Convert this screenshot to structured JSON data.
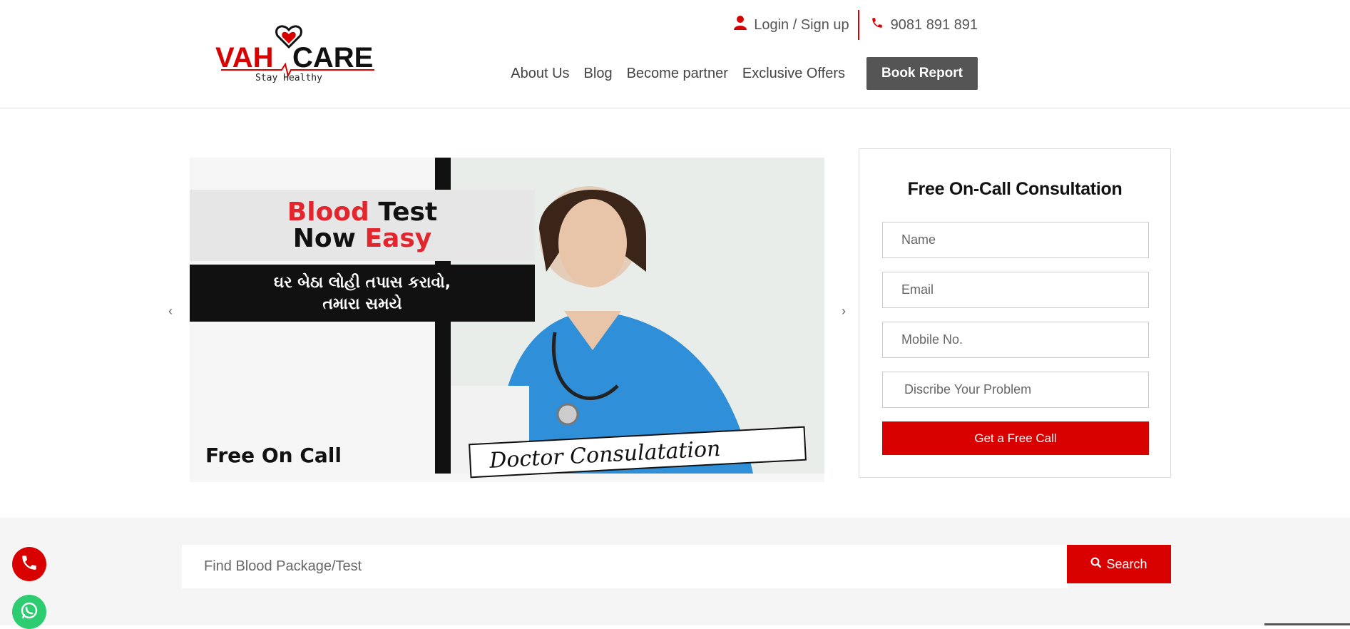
{
  "brand": {
    "name_left": "VAH",
    "name_right": "CARE",
    "tagline": "Stay Healthy"
  },
  "topbar": {
    "login_label": "Login / Sign up",
    "phone": "9081 891 891"
  },
  "nav": {
    "items": [
      "About Us",
      "Blog",
      "Become partner",
      "Exclusive Offers"
    ],
    "book_label": "Book Report"
  },
  "hero": {
    "line1_a": "Blood",
    "line1_b": "Test",
    "line2_a": "Now",
    "line2_b": "Easy",
    "gujarati_line1": "ઘર બેઠા લોહી તપાસ કરાવો,",
    "gujarati_line2": "તમારા સમયે",
    "bottom_left": "Free On Call",
    "banner_text": "Doctor Consulatation",
    "prev_arrow": "‹",
    "next_arrow": "›"
  },
  "form": {
    "title": "Free On-Call Consultation",
    "name_placeholder": "Name",
    "email_placeholder": "Email",
    "mobile_placeholder": "Mobile No.",
    "problem_placeholder": "Discribe Your Problem",
    "submit_label": "Get a Free Call"
  },
  "search": {
    "placeholder": "Find Blood Package/Test",
    "button_label": "Search"
  },
  "colors": {
    "accent": "#d90000",
    "dark_button": "#555555",
    "whatsapp": "#2ecc71"
  }
}
